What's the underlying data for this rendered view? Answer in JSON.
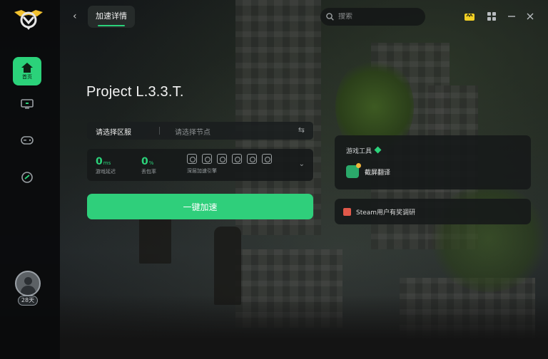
{
  "header": {
    "tab_label": "加速详情",
    "search_placeholder": "搜索"
  },
  "sidebar": {
    "home_label": "首页",
    "vip_days": "28天"
  },
  "game": {
    "title": "Project L.3.3.T.",
    "region_label": "请选择区服",
    "node_placeholder": "请选择节点"
  },
  "stats": {
    "latency_value": "0",
    "latency_unit": "ms",
    "latency_label": "游戏延迟",
    "loss_value": "0",
    "loss_unit": "%",
    "loss_label": "丢包率",
    "tools_label": "深层加速引擎"
  },
  "actions": {
    "accelerate_label": "一键加速"
  },
  "tools_panel": {
    "title": "游戏工具",
    "screenshot_translate": "截屏翻译"
  },
  "survey": {
    "label": "Steam用户有奖调研"
  },
  "colors": {
    "accent": "#2bd27a",
    "vip_accent": "#f2d024"
  }
}
